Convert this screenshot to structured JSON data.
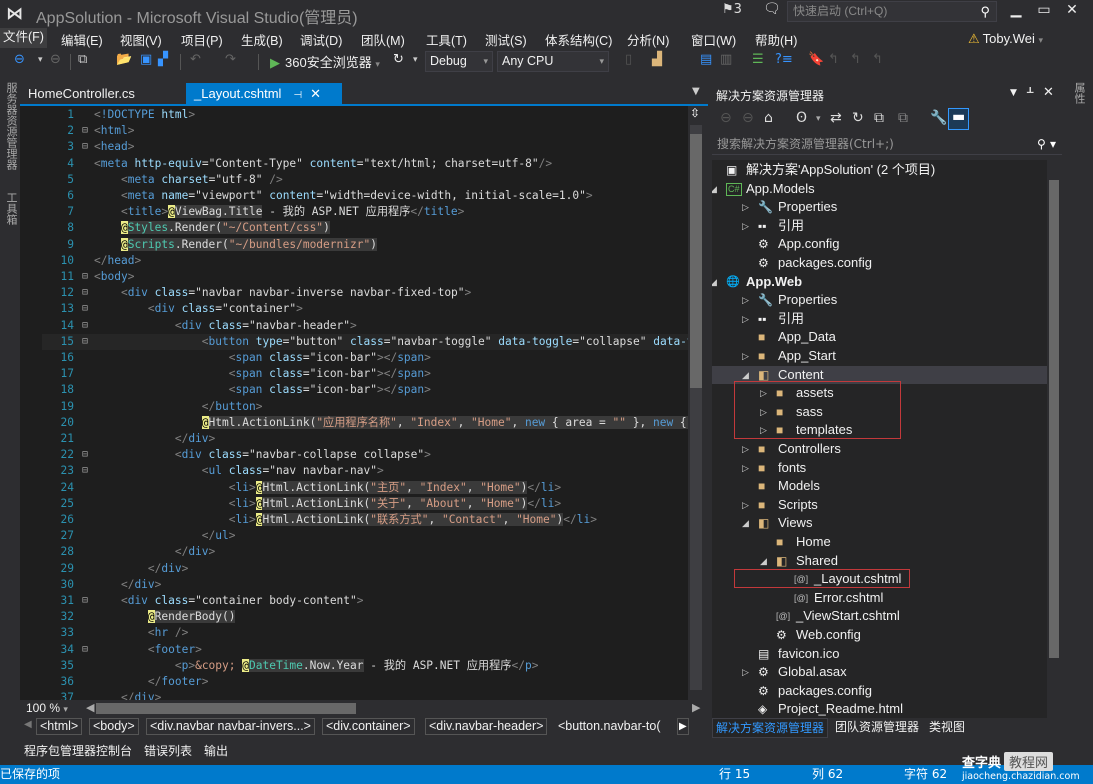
{
  "window": {
    "title": "AppSolution - Microsoft Visual Studio(管理员)",
    "notification_count": "3",
    "quick_launch_placeholder": "快速启动 (Ctrl+Q)",
    "user": "Toby.Wei"
  },
  "menu": [
    "文件(F)",
    "编辑(E)",
    "视图(V)",
    "项目(P)",
    "生成(B)",
    "调试(D)",
    "团队(M)",
    "工具(T)",
    "测试(S)",
    "体系结构(C)",
    "分析(N)",
    "窗口(W)",
    "帮助(H)"
  ],
  "toolbar": {
    "run_target": "360安全浏览器",
    "configuration": "Debug",
    "platform": "Any CPU"
  },
  "left_rail": [
    "服务器资源管理器",
    "工具箱"
  ],
  "right_rail": [
    "属性"
  ],
  "doc_tabs": [
    {
      "label": "HomeController.cs",
      "active": false
    },
    {
      "label": "_Layout.cshtml",
      "active": true
    }
  ],
  "editor": {
    "zoom": "100 %",
    "lines": [
      {
        "n": "1",
        "fold": "",
        "html": "<span class='d'>&lt;</span><span class='t'>!DOCTYPE</span> <span class='a'>html</span><span class='d'>&gt;</span>"
      },
      {
        "n": "2",
        "fold": "⊟",
        "html": "<span class='d'>&lt;</span><span class='t'>html</span><span class='d'>&gt;</span>"
      },
      {
        "n": "3",
        "fold": "⊟",
        "html": "<span class='d'>&lt;</span><span class='t'>head</span><span class='d'>&gt;</span>"
      },
      {
        "n": "4",
        "fold": "",
        "html": "<span class='d'>&lt;</span><span class='t'>meta</span> <span class='a'>http-equiv</span>=<span class='plain'>\"Content-Type\"</span> <span class='a'>content</span>=<span class='plain'>\"text/html; charset=utf-8\"</span><span class='d'>/&gt;</span>"
      },
      {
        "n": "5",
        "fold": "",
        "html": "    <span class='d'>&lt;</span><span class='t'>meta</span> <span class='a'>charset</span>=<span class='plain'>\"utf-8\"</span> <span class='d'>/&gt;</span>"
      },
      {
        "n": "6",
        "fold": "",
        "html": "    <span class='d'>&lt;</span><span class='t'>meta</span> <span class='a'>name</span>=<span class='plain'>\"viewport\"</span> <span class='a'>content</span>=<span class='plain'>\"width=device-width, initial-scale=1.0\"</span><span class='d'>&gt;</span>"
      },
      {
        "n": "7",
        "fold": "",
        "html": "    <span class='d'>&lt;</span><span class='t'>title</span><span class='d'>&gt;</span><span class='at'>@</span><span class='r'>ViewBag.Title</span> - 我的 ASP.NET 应用程序<span class='d'>&lt;/</span><span class='t'>title</span><span class='d'>&gt;</span>"
      },
      {
        "n": "8",
        "fold": "",
        "html": "    <span class='at'>@</span><span class='r'><span class='cls'>Styles</span>.Render(<span class='s'>\"~/Content/css\"</span>)</span>"
      },
      {
        "n": "9",
        "fold": "",
        "html": "    <span class='at'>@</span><span class='r'><span class='cls'>Scripts</span>.Render(<span class='s'>\"~/bundles/modernizr\"</span>)</span>"
      },
      {
        "n": "10",
        "fold": "",
        "html": "<span class='d'>&lt;/</span><span class='t'>head</span><span class='d'>&gt;</span>"
      },
      {
        "n": "11",
        "fold": "⊟",
        "html": "<span class='d'>&lt;</span><span class='t'>body</span><span class='d'>&gt;</span>"
      },
      {
        "n": "12",
        "fold": "⊟",
        "html": "    <span class='d'>&lt;</span><span class='t'>div</span> <span class='a'>class</span>=<span class='plain'>\"navbar navbar-inverse navbar-fixed-top\"</span><span class='d'>&gt;</span>"
      },
      {
        "n": "13",
        "fold": "⊟",
        "html": "        <span class='d'>&lt;</span><span class='t'>div</span> <span class='a'>class</span>=<span class='plain'>\"container\"</span><span class='d'>&gt;</span>"
      },
      {
        "n": "14",
        "fold": "⊟",
        "html": "            <span class='d'>&lt;</span><span class='t'>div</span> <span class='a'>class</span>=<span class='plain'>\"navbar-header\"</span><span class='d'>&gt;</span>"
      },
      {
        "n": "15",
        "fold": "⊟",
        "html": "                <span class='d'>&lt;</span><span class='t'>button</span> <span class='a'>type</span>=<span class='plain'>\"button\"</span> <span class='a'>class</span>=<span class='plain'>\"navbar-toggle\"</span> <span class='a'>data-toggle</span>=<span class='plain'>\"collapse\"</span> <span class='a'>data-targ</span>"
      },
      {
        "n": "16",
        "fold": "",
        "html": "                    <span class='d'>&lt;</span><span class='t'>span</span> <span class='a'>class</span>=<span class='plain'>\"icon-bar\"</span><span class='d'>&gt;&lt;/</span><span class='t'>span</span><span class='d'>&gt;</span>"
      },
      {
        "n": "17",
        "fold": "",
        "html": "                    <span class='d'>&lt;</span><span class='t'>span</span> <span class='a'>class</span>=<span class='plain'>\"icon-bar\"</span><span class='d'>&gt;&lt;/</span><span class='t'>span</span><span class='d'>&gt;</span>"
      },
      {
        "n": "18",
        "fold": "",
        "html": "                    <span class='d'>&lt;</span><span class='t'>span</span> <span class='a'>class</span>=<span class='plain'>\"icon-bar\"</span><span class='d'>&gt;&lt;/</span><span class='t'>span</span><span class='d'>&gt;</span>"
      },
      {
        "n": "19",
        "fold": "",
        "html": "                <span class='d'>&lt;/</span><span class='t'>button</span><span class='d'>&gt;</span>"
      },
      {
        "n": "20",
        "fold": "",
        "html": "                <span class='at'>@</span><span class='r'>Html.ActionLink(<span class='s'>\"应用程序名称\"</span>, <span class='s'>\"Index\"</span>, <span class='s'>\"Home\"</span>, <span class='k'>new</span> { area = <span class='s'>\"\"</span> }, <span class='k'>new</span> { @</span>"
      },
      {
        "n": "21",
        "fold": "",
        "html": "            <span class='d'>&lt;/</span><span class='t'>div</span><span class='d'>&gt;</span>"
      },
      {
        "n": "22",
        "fold": "⊟",
        "html": "            <span class='d'>&lt;</span><span class='t'>div</span> <span class='a'>class</span>=<span class='plain'>\"navbar-collapse collapse\"</span><span class='d'>&gt;</span>"
      },
      {
        "n": "23",
        "fold": "⊟",
        "html": "                <span class='d'>&lt;</span><span class='t'>ul</span> <span class='a'>class</span>=<span class='plain'>\"nav navbar-nav\"</span><span class='d'>&gt;</span>"
      },
      {
        "n": "24",
        "fold": "",
        "html": "                    <span class='d'>&lt;</span><span class='t'>li</span><span class='d'>&gt;</span><span class='at'>@</span><span class='r'>Html.ActionLink(<span class='s'>\"主页\"</span>, <span class='s'>\"Index\"</span>, <span class='s'>\"Home\"</span>)</span><span class='d'>&lt;/</span><span class='t'>li</span><span class='d'>&gt;</span>"
      },
      {
        "n": "25",
        "fold": "",
        "html": "                    <span class='d'>&lt;</span><span class='t'>li</span><span class='d'>&gt;</span><span class='at'>@</span><span class='r'>Html.ActionLink(<span class='s'>\"关于\"</span>, <span class='s'>\"About\"</span>, <span class='s'>\"Home\"</span>)</span><span class='d'>&lt;/</span><span class='t'>li</span><span class='d'>&gt;</span>"
      },
      {
        "n": "26",
        "fold": "",
        "html": "                    <span class='d'>&lt;</span><span class='t'>li</span><span class='d'>&gt;</span><span class='at'>@</span><span class='r'>Html.ActionLink(<span class='s'>\"联系方式\"</span>, <span class='s'>\"Contact\"</span>, <span class='s'>\"Home\"</span>)</span><span class='d'>&lt;/</span><span class='t'>li</span><span class='d'>&gt;</span>"
      },
      {
        "n": "27",
        "fold": "",
        "html": "                <span class='d'>&lt;/</span><span class='t'>ul</span><span class='d'>&gt;</span>"
      },
      {
        "n": "28",
        "fold": "",
        "html": "            <span class='d'>&lt;/</span><span class='t'>div</span><span class='d'>&gt;</span>"
      },
      {
        "n": "29",
        "fold": "",
        "html": "        <span class='d'>&lt;/</span><span class='t'>div</span><span class='d'>&gt;</span>"
      },
      {
        "n": "30",
        "fold": "",
        "html": "    <span class='d'>&lt;/</span><span class='t'>div</span><span class='d'>&gt;</span>"
      },
      {
        "n": "31",
        "fold": "⊟",
        "html": "    <span class='d'>&lt;</span><span class='t'>div</span> <span class='a'>class</span>=<span class='plain'>\"container body-content\"</span><span class='d'>&gt;</span>"
      },
      {
        "n": "32",
        "fold": "",
        "html": "        <span class='at'>@</span><span class='r'>RenderBody()</span>"
      },
      {
        "n": "33",
        "fold": "",
        "html": "        <span class='d'>&lt;</span><span class='t'>hr</span> <span class='d'>/&gt;</span>"
      },
      {
        "n": "34",
        "fold": "⊟",
        "html": "        <span class='d'>&lt;</span><span class='t'>footer</span><span class='d'>&gt;</span>"
      },
      {
        "n": "35",
        "fold": "",
        "html": "            <span class='d'>&lt;</span><span class='t'>p</span><span class='d'>&gt;</span><span class='s'>&amp;copy;</span> <span class='at'>@</span><span class='r'><span class='cls'>DateTime</span>.Now.Year</span> - 我的 ASP.NET 应用程序<span class='d'>&lt;/</span><span class='t'>p</span><span class='d'>&gt;</span>"
      },
      {
        "n": "36",
        "fold": "",
        "html": "        <span class='d'>&lt;/</span><span class='t'>footer</span><span class='d'>&gt;</span>"
      },
      {
        "n": "37",
        "fold": "",
        "html": "    <span class='d'>&lt;/</span><span class='t'>div</span><span class='d'>&gt;</span>"
      }
    ]
  },
  "breadcrumbs": [
    "<html>",
    "<body>",
    "<div.navbar navbar-invers...>",
    "<div.container>",
    "<div.navbar-header>",
    "<button.navbar-to("
  ],
  "bottom_tabs": [
    "程序包管理器控制台",
    "错误列表",
    "输出"
  ],
  "solution_explorer": {
    "title": "解决方案资源管理器",
    "search_placeholder": "搜索解决方案资源管理器(Ctrl+;)",
    "nodes": [
      {
        "label": "解决方案'AppSolution' (2 个项目)",
        "level": 0,
        "exp": "",
        "icon": "solution-icon",
        "glyph": "▣",
        "bold": false
      },
      {
        "label": "App.Models",
        "level": 0,
        "exp": "◢",
        "icon": "csharp-project-icon",
        "glyph": "C#",
        "bold": false
      },
      {
        "label": "Properties",
        "level": 1,
        "exp": "▷",
        "icon": "wrench-icon",
        "glyph": "🔧",
        "bold": false
      },
      {
        "label": "引用",
        "level": 1,
        "exp": "▷",
        "icon": "references-icon",
        "glyph": "▪▪",
        "bold": false
      },
      {
        "label": "App.config",
        "level": 1,
        "exp": "",
        "icon": "config-file-icon",
        "glyph": "⚙",
        "bold": false
      },
      {
        "label": "packages.config",
        "level": 1,
        "exp": "",
        "icon": "config-file-icon",
        "glyph": "⚙",
        "bold": false
      },
      {
        "label": "App.Web",
        "level": 0,
        "exp": "◢",
        "icon": "web-project-icon",
        "glyph": "🌐",
        "bold": true
      },
      {
        "label": "Properties",
        "level": 1,
        "exp": "▷",
        "icon": "wrench-icon",
        "glyph": "🔧",
        "bold": false
      },
      {
        "label": "引用",
        "level": 1,
        "exp": "▷",
        "icon": "references-icon",
        "glyph": "▪▪",
        "bold": false
      },
      {
        "label": "App_Data",
        "level": 1,
        "exp": "",
        "icon": "folder-icon",
        "glyph": "■",
        "bold": false
      },
      {
        "label": "App_Start",
        "level": 1,
        "exp": "▷",
        "icon": "folder-icon",
        "glyph": "■",
        "bold": false
      },
      {
        "label": "Content",
        "level": 1,
        "exp": "◢",
        "icon": "folder-open-icon",
        "glyph": "◧",
        "bold": false,
        "selected": true
      },
      {
        "label": "assets",
        "level": 2,
        "exp": "▷",
        "icon": "folder-icon",
        "glyph": "■",
        "bold": false
      },
      {
        "label": "sass",
        "level": 2,
        "exp": "▷",
        "icon": "folder-icon",
        "glyph": "■",
        "bold": false
      },
      {
        "label": "templates",
        "level": 2,
        "exp": "▷",
        "icon": "folder-icon",
        "glyph": "■",
        "bold": false
      },
      {
        "label": "Controllers",
        "level": 1,
        "exp": "▷",
        "icon": "folder-icon",
        "glyph": "■",
        "bold": false
      },
      {
        "label": "fonts",
        "level": 1,
        "exp": "▷",
        "icon": "folder-icon",
        "glyph": "■",
        "bold": false
      },
      {
        "label": "Models",
        "level": 1,
        "exp": "",
        "icon": "folder-icon",
        "glyph": "■",
        "bold": false
      },
      {
        "label": "Scripts",
        "level": 1,
        "exp": "▷",
        "icon": "folder-icon",
        "glyph": "■",
        "bold": false
      },
      {
        "label": "Views",
        "level": 1,
        "exp": "◢",
        "icon": "folder-open-icon",
        "glyph": "◧",
        "bold": false
      },
      {
        "label": "Home",
        "level": 2,
        "exp": "",
        "icon": "folder-icon",
        "glyph": "■",
        "bold": false
      },
      {
        "label": "Shared",
        "level": 2,
        "exp": "◢",
        "icon": "folder-open-icon",
        "glyph": "◧",
        "bold": false
      },
      {
        "label": "_Layout.cshtml",
        "level": 3,
        "exp": "",
        "icon": "razor-file-icon",
        "glyph": "[@]",
        "bold": false
      },
      {
        "label": "Error.cshtml",
        "level": 3,
        "exp": "",
        "icon": "razor-file-icon",
        "glyph": "[@]",
        "bold": false
      },
      {
        "label": "_ViewStart.cshtml",
        "level": 2,
        "exp": "",
        "icon": "razor-file-icon",
        "glyph": "[@]",
        "bold": false
      },
      {
        "label": "Web.config",
        "level": 2,
        "exp": "",
        "icon": "config-file-icon",
        "glyph": "⚙",
        "bold": false
      },
      {
        "label": "favicon.ico",
        "level": 1,
        "exp": "",
        "icon": "image-file-icon",
        "glyph": "▤",
        "bold": false
      },
      {
        "label": "Global.asax",
        "level": 1,
        "exp": "▷",
        "icon": "asax-file-icon",
        "glyph": "⚙",
        "bold": false
      },
      {
        "label": "packages.config",
        "level": 1,
        "exp": "",
        "icon": "config-file-icon",
        "glyph": "⚙",
        "bold": false
      },
      {
        "label": "Project_Readme.html",
        "level": 1,
        "exp": "",
        "icon": "html-file-icon",
        "glyph": "◈",
        "bold": false
      }
    ],
    "tabs": [
      {
        "label": "解决方案资源管理器",
        "active": true
      },
      {
        "label": "团队资源管理器",
        "active": false
      },
      {
        "label": "类视图",
        "active": false
      }
    ]
  },
  "statusbar": {
    "message": "已保存的项",
    "line": "行 15",
    "col": "列 62",
    "char": "字符 62"
  },
  "watermark": {
    "brand": "查字典",
    "box": "教程网",
    "url": "jiaocheng.chazidian.com"
  },
  "colors": {
    "accent": "#007acc",
    "highlight_box": "#c3393b",
    "folder": "#dcb67a"
  }
}
